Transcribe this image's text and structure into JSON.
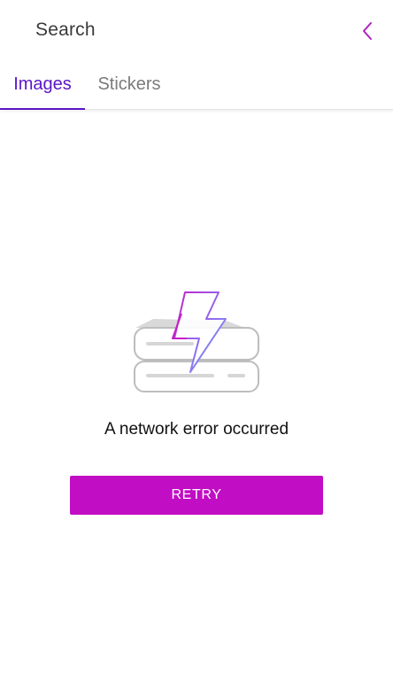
{
  "header": {
    "title": "Search",
    "back_icon": "chevron-left-icon"
  },
  "tabs": [
    {
      "label": "Images",
      "active": true
    },
    {
      "label": "Stickers",
      "active": false
    }
  ],
  "error": {
    "icon": "network-error-icon",
    "message": "A network error occurred",
    "retry_label": "RETRY"
  },
  "colors": {
    "accent_tab": "#5b16c7",
    "accent_button": "#c10dc4",
    "back_icon": "#b01fc0"
  }
}
